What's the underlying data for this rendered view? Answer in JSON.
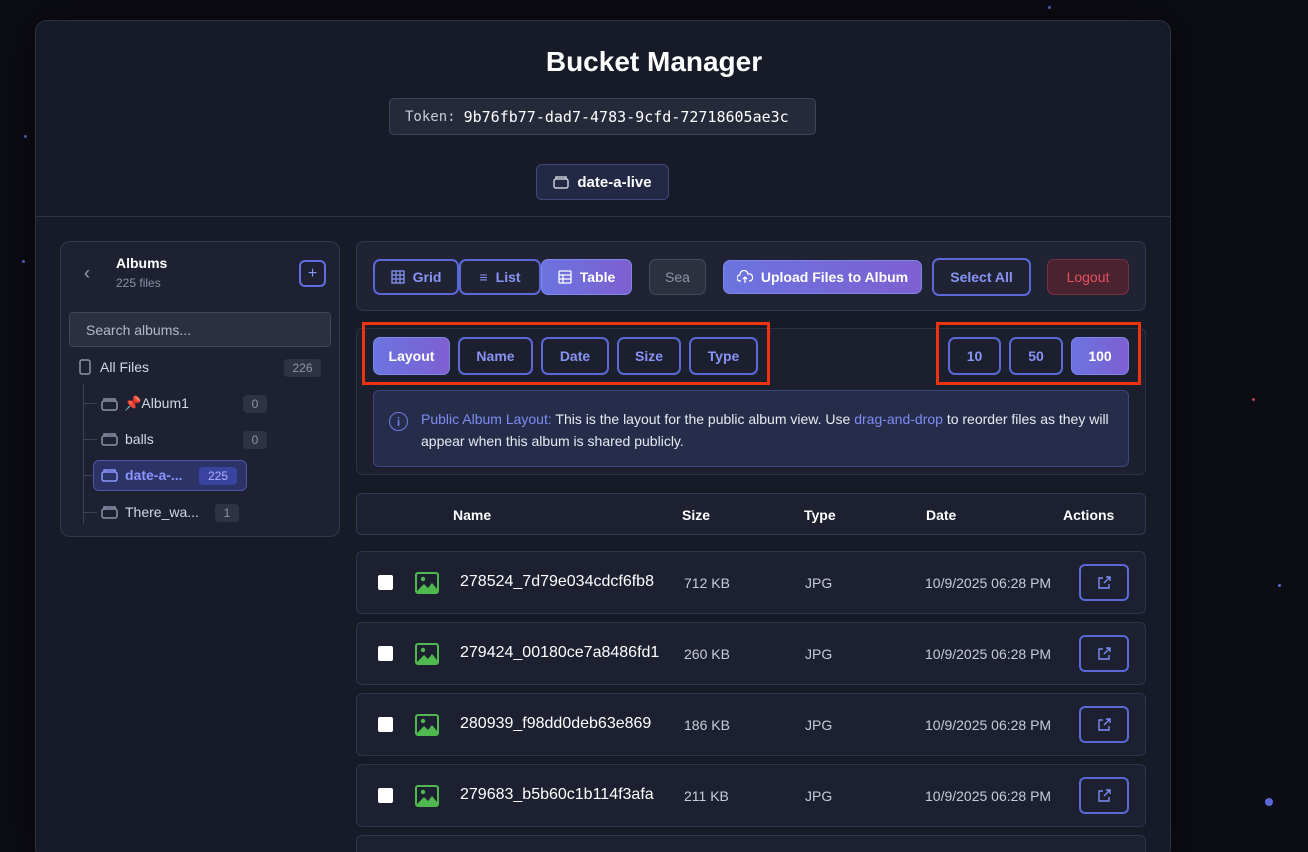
{
  "app": {
    "title": "Bucket Manager",
    "token_label": "Token:",
    "token_value": "9b76fb77-dad7-4783-9cfd-72718605ae3c",
    "bucket_name": "date-a-live"
  },
  "sidebar": {
    "title": "Albums",
    "subtitle": "225 files",
    "search_placeholder": "Search albums...",
    "all_files": {
      "label": "All Files",
      "count": "226"
    },
    "albums": [
      {
        "label": "📌Album1",
        "count": "0"
      },
      {
        "label": "balls",
        "count": "0"
      },
      {
        "label": "date-a-...",
        "count": "225",
        "active": true
      },
      {
        "label": "There_wa...",
        "count": "1"
      }
    ]
  },
  "toolbar": {
    "view_grid": "Grid",
    "view_list": "List",
    "view_table": "Table",
    "search_stub": "Sea",
    "upload": "Upload Files to Album",
    "select_all": "Select All",
    "logout": "Logout"
  },
  "sort": {
    "buttons": [
      "Layout",
      "Name",
      "Date",
      "Size",
      "Type"
    ],
    "active": "Layout",
    "page_sizes": [
      "10",
      "50",
      "100"
    ],
    "active_page_size": "100"
  },
  "info": {
    "label": "Public Album Layout:",
    "text1": " This is the layout for the public album view. Use ",
    "link": "drag-and-drop",
    "text2": " to reorder files as they will appear when this album is shared publicly."
  },
  "table": {
    "headers": {
      "name": "Name",
      "size": "Size",
      "type": "Type",
      "date": "Date",
      "actions": "Actions"
    },
    "rows": [
      {
        "name": "278524_7d79e034cdcf6fb8",
        "size": "712 KB",
        "type": "JPG",
        "date": "10/9/2025 06:28 PM"
      },
      {
        "name": "279424_00180ce7a8486fd1",
        "size": "260 KB",
        "type": "JPG",
        "date": "10/9/2025 06:28 PM"
      },
      {
        "name": "280939_f98dd0deb63e869",
        "size": "186 KB",
        "type": "JPG",
        "date": "10/9/2025 06:28 PM"
      },
      {
        "name": "279683_b5b60c1b114f3afa",
        "size": "211 KB",
        "type": "JPG",
        "date": "10/9/2025 06:28 PM"
      }
    ]
  },
  "colors": {
    "accent": "#6b74e0",
    "highlight_box": "#f0330f",
    "logout": "#e9505c"
  }
}
